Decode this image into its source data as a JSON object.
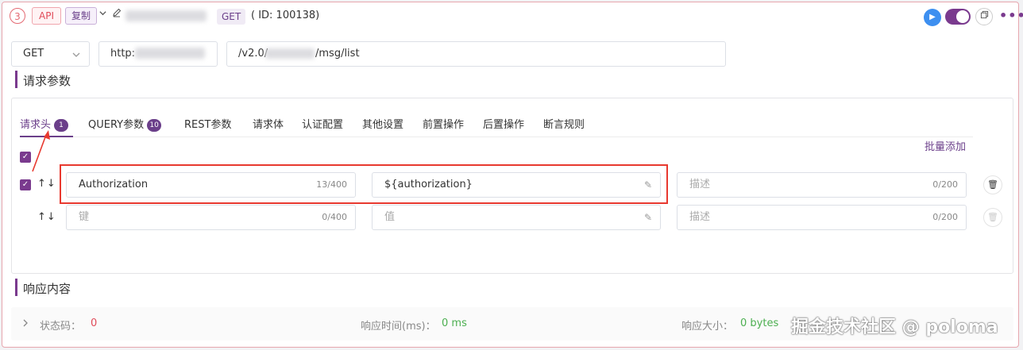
{
  "header": {
    "step": "3",
    "api_tag": "API",
    "copy_tag": "复制",
    "method_tag": "GET",
    "api_id": "( ID: 100138)"
  },
  "request": {
    "method": "GET",
    "base_url": "http:",
    "path_prefix": "/v2.0/",
    "path_suffix": "/msg/list"
  },
  "sections": {
    "params_title": "请求参数",
    "response_title": "响应内容"
  },
  "tabs": [
    {
      "label": "请求头",
      "count": "1"
    },
    {
      "label": "QUERY参数",
      "count": "10"
    },
    {
      "label": "REST参数"
    },
    {
      "label": "请求体"
    },
    {
      "label": "认证配置"
    },
    {
      "label": "其他设置"
    },
    {
      "label": "前置操作"
    },
    {
      "label": "后置操作"
    },
    {
      "label": "断言规则"
    }
  ],
  "bulk_add": "批量添加",
  "rows": [
    {
      "key": "Authorization",
      "key_count": "13/400",
      "value": "${authorization}",
      "desc_placeholder": "描述",
      "desc_count": "0/200"
    },
    {
      "key_placeholder": "键",
      "key_count": "0/400",
      "value_placeholder": "值",
      "desc_placeholder": "描述",
      "desc_count": "0/200"
    }
  ],
  "response": {
    "status_label": "状态码：",
    "status_value": "0",
    "time_label": "响应时间(ms)：",
    "time_value": "0 ms",
    "size_label": "响应大小：",
    "size_value": "0 bytes"
  },
  "watermark": "掘金技术社区 @ poloma",
  "colors": {
    "accent": "#7a3a8e",
    "highlight_box": "#e8392f",
    "success": "#4caf50",
    "error": "#e04b59"
  }
}
